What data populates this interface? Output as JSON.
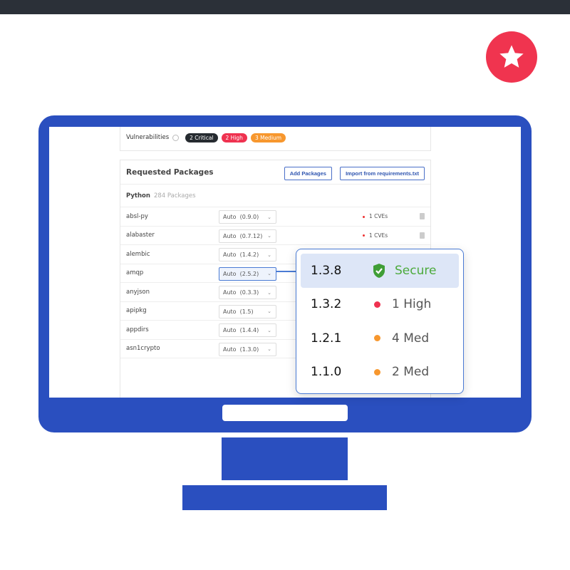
{
  "colors": {
    "monitor": "#2a4fbf",
    "star_badge": "#f0344f",
    "critical": "#262b30",
    "high": "#ef3250",
    "medium": "#f7972e",
    "secure": "#4caa3c",
    "accent": "#4a7bd4"
  },
  "icons": {
    "badge": "star-icon",
    "info": "info-icon",
    "delete": "trash-icon",
    "secure": "shield-check-icon"
  },
  "vulnerabilities": {
    "label": "Vulnerabilities",
    "critical": "2 Critical",
    "high": "2 High",
    "medium": "3 Medium"
  },
  "packages": {
    "title": "Requested Packages",
    "add_label": "Add Packages",
    "import_label": "Import from requirements.txt",
    "language": "Python",
    "count": "284 Packages",
    "rows": [
      {
        "name": "absl-py",
        "version": "Auto  (0.9.0)",
        "cves": "1 CVEs"
      },
      {
        "name": "alabaster",
        "version": "Auto  (0.7.12)",
        "cves": "1 CVEs"
      },
      {
        "name": "alembic",
        "version": "Auto  (1.4.2)"
      },
      {
        "name": "amqp",
        "version": "Auto  (2.5.2)"
      },
      {
        "name": "anyjson",
        "version": "Auto  (0.3.3)"
      },
      {
        "name": "apipkg",
        "version": "Auto  (1.5)"
      },
      {
        "name": "appdirs",
        "version": "Auto  (1.4.4)"
      },
      {
        "name": "asn1crypto",
        "version": "Auto  (1.3.0)"
      }
    ]
  },
  "version_dropdown": {
    "options": [
      {
        "version": "1.3.8",
        "status": "Secure",
        "severity": "secure"
      },
      {
        "version": "1.3.2",
        "status": "1 High",
        "severity": "high"
      },
      {
        "version": "1.2.1",
        "status": "4 Med",
        "severity": "medium"
      },
      {
        "version": "1.1.0",
        "status": "2 Med",
        "severity": "medium"
      }
    ]
  }
}
